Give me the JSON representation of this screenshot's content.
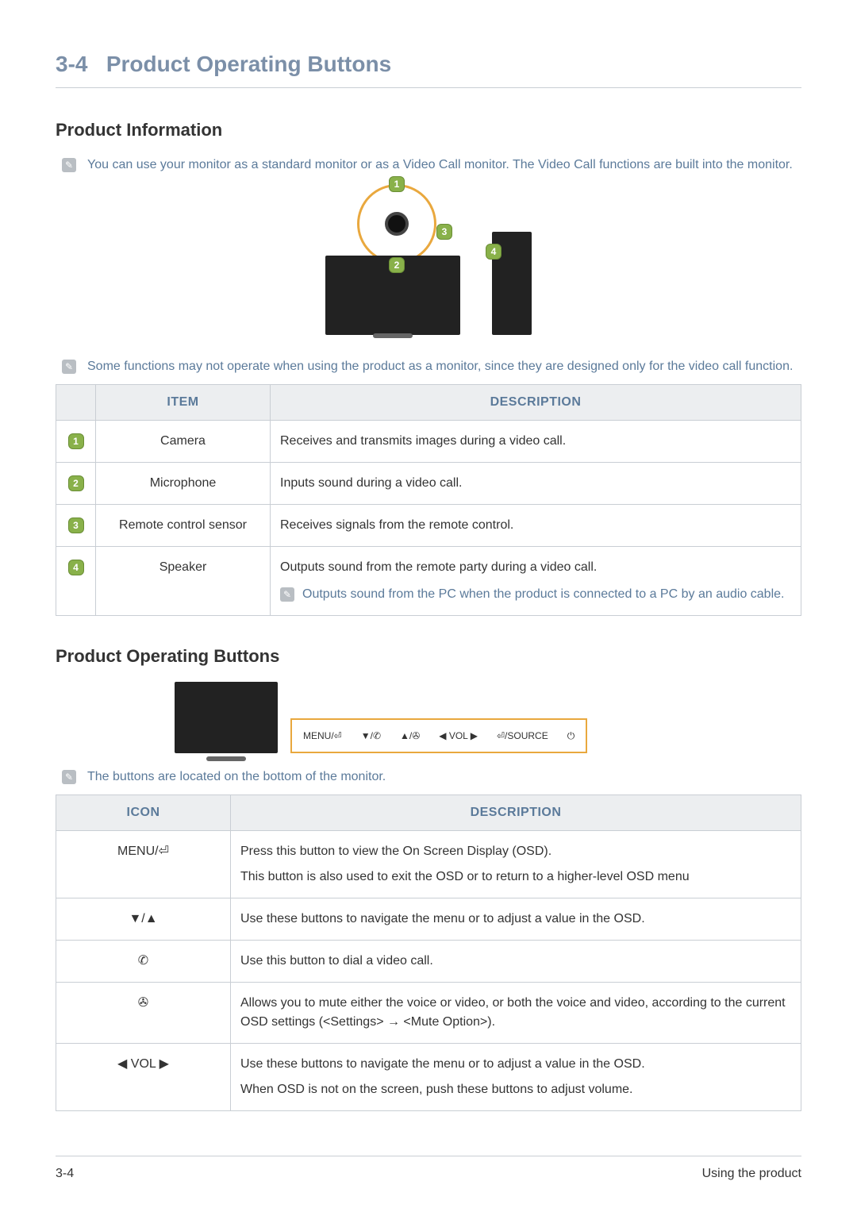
{
  "header": {
    "section_num": "3-4",
    "title": "Product Operating Buttons"
  },
  "footer": {
    "left": "3-4",
    "right": "Using the product"
  },
  "s1": {
    "title": "Product Information",
    "note1": "You can use your monitor as a standard monitor or as a Video Call monitor. The Video Call functions are built into the monitor.",
    "note2": "Some functions may not operate when using the product as a monitor, since they are designed only for the video call function.",
    "table": {
      "head_col1": "ITEM",
      "head_col2": "DESCRIPTION",
      "rows": [
        {
          "num": "1",
          "item": "Camera",
          "desc": "Receives and transmits images during a video call."
        },
        {
          "num": "2",
          "item": "Microphone",
          "desc": "Inputs sound during a video call."
        },
        {
          "num": "3",
          "item": "Remote control sensor",
          "desc": "Receives signals from the remote control."
        },
        {
          "num": "4",
          "item": "Speaker",
          "desc": "Outputs sound from the remote party during a video call.",
          "note": "Outputs sound from the PC when the product is connected to a PC by an audio cable."
        }
      ]
    }
  },
  "s2": {
    "title": "Product Operating Buttons",
    "note1": "The buttons are located on the bottom of the monitor.",
    "panel": {
      "menu": "MENU/⏎",
      "down_call": "▼/✆",
      "up_mute": "▲/✇",
      "vol": "◀ VOL ▶",
      "source": "⏎/SOURCE",
      "power": "⏻"
    },
    "table": {
      "head_col1": "ICON",
      "head_col2": "DESCRIPTION",
      "rows": [
        {
          "icon": "MENU/⏎",
          "desc1": "Press this button to view the On Screen Display (OSD).",
          "desc2": "This button is also used to exit the OSD or to return to a higher-level OSD menu"
        },
        {
          "icon": "▼/▲",
          "desc1": "Use these buttons to navigate the menu or to adjust a value in the OSD."
        },
        {
          "icon": "✆",
          "desc1": "Use this button to dial a video call."
        },
        {
          "icon": "✇",
          "desc1": "Allows you to mute either the voice or video, or both the voice and video, according to the current OSD settings (<Settings> → <Mute Option>)."
        },
        {
          "icon": "◀ VOL ▶",
          "desc1": "Use these buttons to navigate the menu or to adjust a value in the OSD.",
          "desc2": "When OSD is not on the screen, push these buttons to adjust volume."
        }
      ]
    }
  }
}
